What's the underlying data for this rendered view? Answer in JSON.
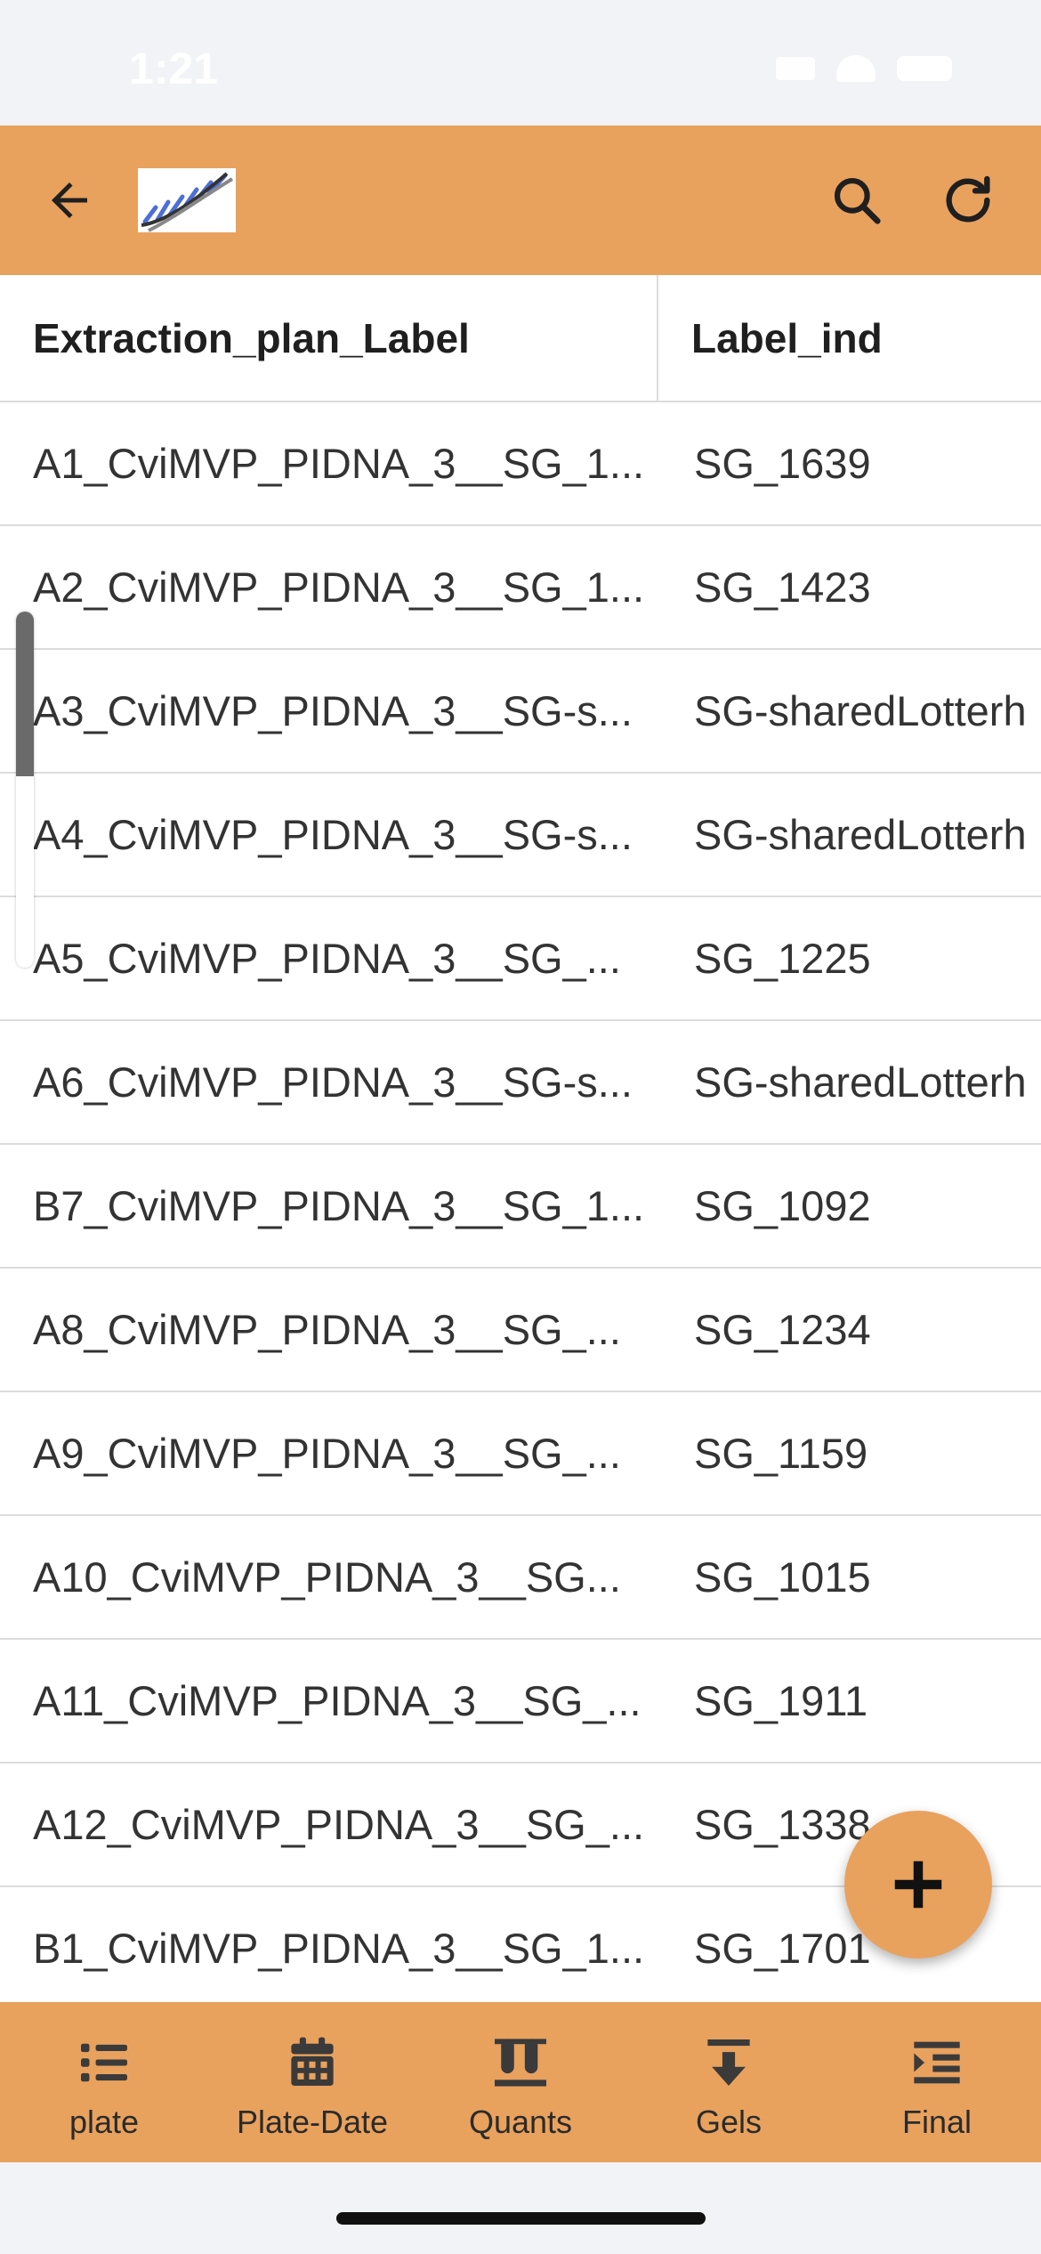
{
  "status_bar": {
    "time": "1:21"
  },
  "app_bar": {
    "back_icon": "arrow-left-icon",
    "logo_icon": "dna-helix-logo",
    "search_icon": "search-icon",
    "refresh_icon": "refresh-icon",
    "background_color": "#e8a25e"
  },
  "table": {
    "columns": [
      "Extraction_plan_Label",
      "Label_ind"
    ],
    "rows": [
      [
        "A1_CviMVP_PIDNA_3__SG_1...",
        "SG_1639"
      ],
      [
        "A2_CviMVP_PIDNA_3__SG_1...",
        "SG_1423"
      ],
      [
        "A3_CviMVP_PIDNA_3__SG-s...",
        "SG-sharedLotterh"
      ],
      [
        "A4_CviMVP_PIDNA_3__SG-s...",
        "SG-sharedLotterh"
      ],
      [
        "A5_CviMVP_PIDNA_3__SG_...",
        "SG_1225"
      ],
      [
        "A6_CviMVP_PIDNA_3__SG-s...",
        "SG-sharedLotterh"
      ],
      [
        "B7_CviMVP_PIDNA_3__SG_1...",
        "SG_1092"
      ],
      [
        "A8_CviMVP_PIDNA_3__SG_...",
        "SG_1234"
      ],
      [
        "A9_CviMVP_PIDNA_3__SG_...",
        "SG_1159"
      ],
      [
        "A10_CviMVP_PIDNA_3__SG...",
        "SG_1015"
      ],
      [
        "A11_CviMVP_PIDNA_3__SG_...",
        "SG_1911"
      ],
      [
        "A12_CviMVP_PIDNA_3__SG_...",
        "SG_1338"
      ],
      [
        "B1_CviMVP_PIDNA_3__SG_1...",
        "SG_1701"
      ]
    ]
  },
  "fab": {
    "icon": "plus-icon"
  },
  "bottom_nav": {
    "items": [
      {
        "label": "plate",
        "icon": "list-icon"
      },
      {
        "label": "Plate-Date",
        "icon": "calendar-icon"
      },
      {
        "label": "Quants",
        "icon": "test-tubes-icon"
      },
      {
        "label": "Gels",
        "icon": "download-icon"
      },
      {
        "label": "Final",
        "icon": "indent-icon"
      }
    ]
  }
}
